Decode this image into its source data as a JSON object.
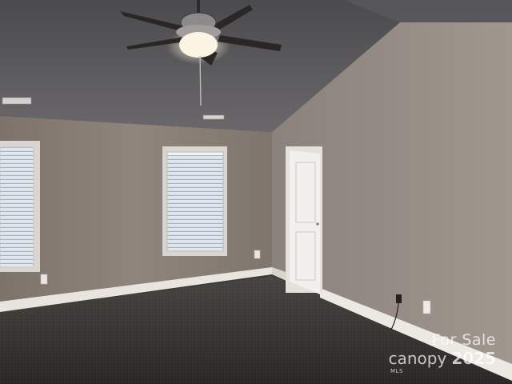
{
  "scene": {
    "subject": "empty-bedroom",
    "colors": {
      "ceiling": "#58575a",
      "wall_left": "#8b8178",
      "wall_right": "#958c85",
      "carpet": "#2f2c2a",
      "trim": "#e6e2dc"
    }
  },
  "watermark": {
    "line1": "For Sale",
    "brand": "canopy",
    "year": "2025",
    "mls": "MLS"
  }
}
